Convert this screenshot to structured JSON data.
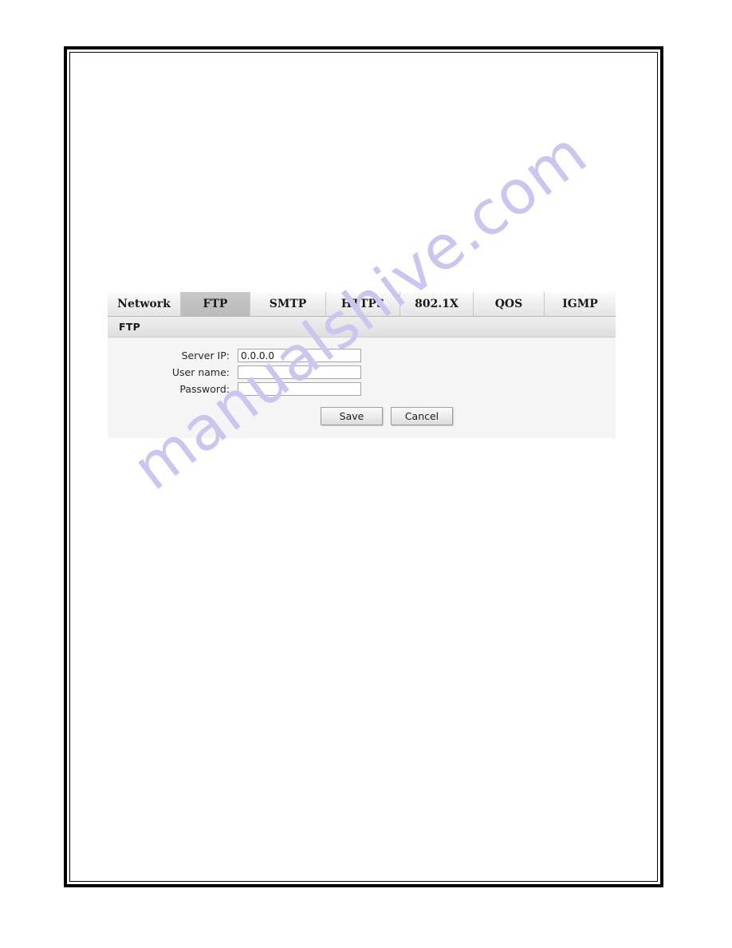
{
  "document": {
    "background_color": "#ffffff",
    "frame_border_color": "#000000"
  },
  "watermark": {
    "text": "manualshive.com",
    "color": "#c9c7ef",
    "rotation_deg": -37
  },
  "settings": {
    "tabs": [
      {
        "label": "Network",
        "active": false,
        "name": "tab-network"
      },
      {
        "label": "FTP",
        "active": true,
        "name": "tab-ftp"
      },
      {
        "label": "SMTP",
        "active": false,
        "name": "tab-smtp"
      },
      {
        "label": "HTTPS",
        "active": false,
        "name": "tab-https"
      },
      {
        "label": "802.1X",
        "active": false,
        "name": "tab-8021x"
      },
      {
        "label": "QOS",
        "active": false,
        "name": "tab-qos"
      },
      {
        "label": "IGMP",
        "active": false,
        "name": "tab-igmp"
      }
    ],
    "active_tab": "FTP",
    "section_header": "FTP",
    "fields": [
      {
        "label": "Server IP:",
        "value": "0.0.0.0",
        "placeholder": "",
        "type": "text"
      },
      {
        "label": "User name:",
        "value": "",
        "placeholder": "",
        "type": "text"
      },
      {
        "label": "Password:",
        "value": "",
        "placeholder": "",
        "type": "password"
      }
    ],
    "buttons": {
      "save_label": "Save",
      "cancel_label": "Cancel"
    },
    "colors": {
      "active_tab_bg": "#c0c0c0",
      "inactive_tab_bg": "#eeeeee",
      "section_header_bg": "#e7e7e7",
      "panel_bg": "#f5f5f5",
      "input_border": "#a5a5a5"
    }
  }
}
